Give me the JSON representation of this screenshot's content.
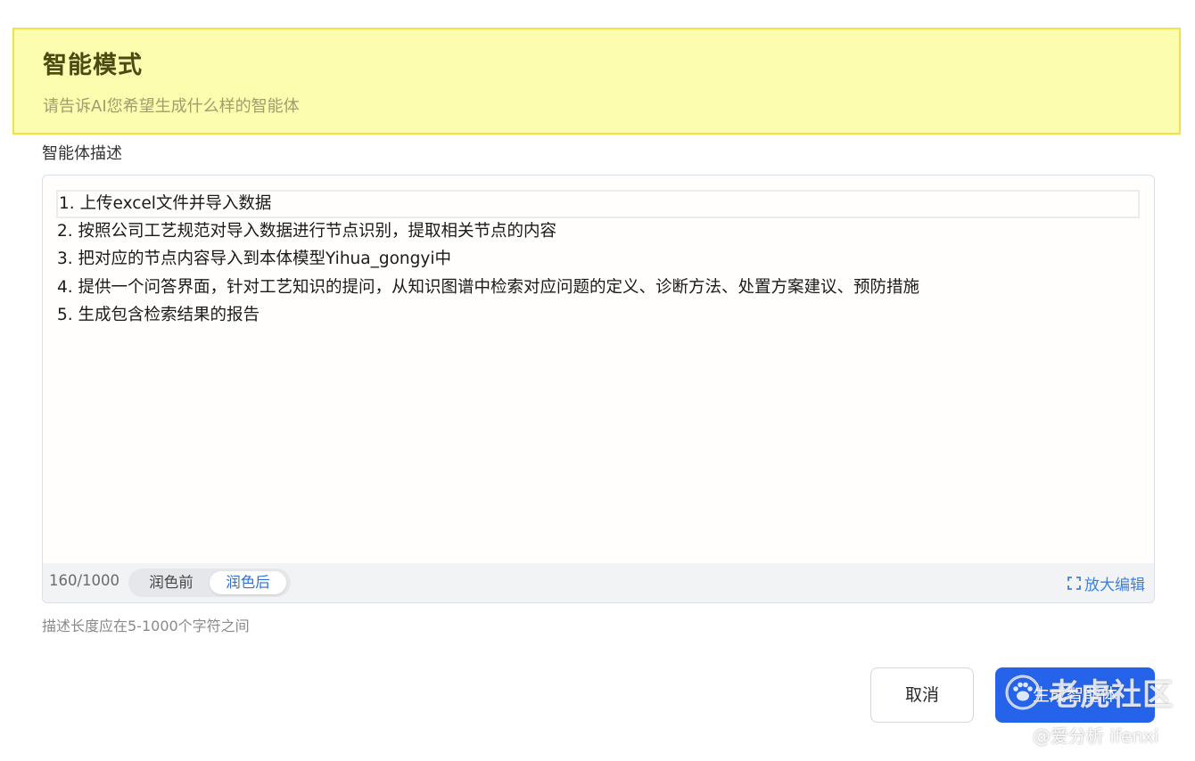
{
  "header": {
    "title": "智能模式",
    "subtitle": "请告诉AI您希望生成什么样的智能体"
  },
  "description": {
    "label": "智能体描述",
    "lines": [
      "1. 上传excel文件并导入数据",
      "2. 按照公司工艺规范对导入数据进行节点识别，提取相关节点的内容",
      "3. 把对应的节点内容导入到本体模型Yihua_gongyi中",
      "4. 提供一个问答界面，针对工艺知识的提问，从知识图谱中检索对应问题的定义、诊断方法、处置方案建议、预防措施",
      "5. 生成包含检索结果的报告"
    ],
    "counter": "160/1000",
    "polish_before": "润色前",
    "polish_after": "润色后",
    "polish_selected": "润色后",
    "expand_label": "放大编辑",
    "expand_icon": "expand-corners-icon",
    "hint": "描述长度应在5-1000个字符之间"
  },
  "actions": {
    "cancel_label": "取消",
    "generate_label": "生成智能体"
  },
  "watermark": {
    "main": "老虎社区",
    "sub": "@爱分析 ifenxi",
    "icon": "tiger-paw-logo-icon"
  },
  "colors": {
    "header_bg": "#fdfdb0",
    "header_border": "#f2e24a",
    "primary": "#2563eb",
    "link": "#3b82e0"
  }
}
